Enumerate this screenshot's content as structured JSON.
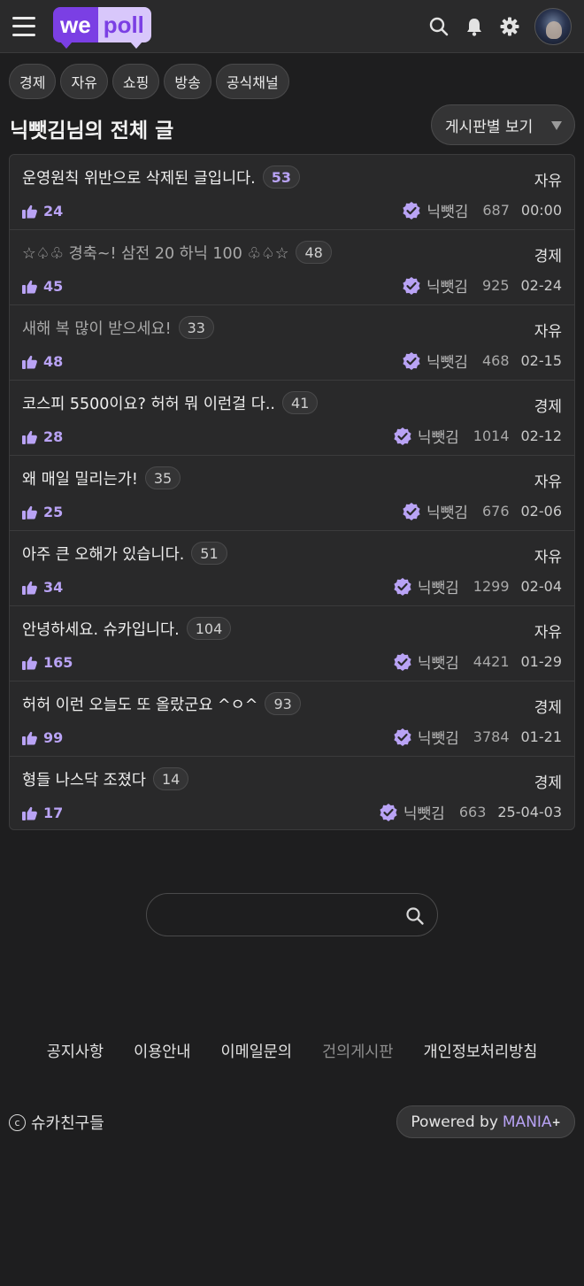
{
  "header": {
    "logo_we": "we",
    "logo_poll": "poll",
    "icons": [
      "search-icon",
      "bell-icon",
      "gear-icon"
    ]
  },
  "categories": [
    "경제",
    "자유",
    "쇼핑",
    "방송",
    "공식채널"
  ],
  "page_title": "닉뺏김님의 전체 글",
  "board_select": "게시판별 보기",
  "posts": [
    {
      "title": "운영원칙 위반으로 삭제된 글입니다.",
      "comments": "53",
      "category": "자유",
      "likes": "24",
      "author": "닉뺏김",
      "views": "687",
      "date": "00:00"
    },
    {
      "title": "☆♤♧ 경축~! 삼전 20 하닉 100 ♧♤☆",
      "comments": "48",
      "category": "경제",
      "likes": "45",
      "author": "닉뺏김",
      "views": "925",
      "date": "02-24"
    },
    {
      "title": "새해 복 많이 받으세요!",
      "comments": "33",
      "category": "자유",
      "likes": "48",
      "author": "닉뺏김",
      "views": "468",
      "date": "02-15"
    },
    {
      "title": "코스피 5500이요? 허허 뭐 이런걸 다..",
      "comments": "41",
      "category": "경제",
      "likes": "28",
      "author": "닉뺏김",
      "views": "1014",
      "date": "02-12"
    },
    {
      "title": "왜 매일 밀리는가!",
      "comments": "35",
      "category": "자유",
      "likes": "25",
      "author": "닉뺏김",
      "views": "676",
      "date": "02-06"
    },
    {
      "title": "아주 큰 오해가 있습니다.",
      "comments": "51",
      "category": "자유",
      "likes": "34",
      "author": "닉뺏김",
      "views": "1299",
      "date": "02-04"
    },
    {
      "title": "안녕하세요. 슈카입니다.",
      "comments": "104",
      "category": "자유",
      "likes": "165",
      "author": "닉뺏김",
      "views": "4421",
      "date": "01-29"
    },
    {
      "title": "허허 이런 오늘도 또 올랐군요 ^ㅇ^",
      "comments": "93",
      "category": "경제",
      "likes": "99",
      "author": "닉뺏김",
      "views": "3784",
      "date": "01-21"
    },
    {
      "title": "형들 나스닥 조졌다",
      "comments": "14",
      "category": "경제",
      "likes": "17",
      "author": "닉뺏김",
      "views": "663",
      "date": "25-04-03"
    }
  ],
  "search": {
    "value": "",
    "placeholder": ""
  },
  "footer": {
    "links": [
      "공지사항",
      "이용안내",
      "이메일문의",
      "건의게시판",
      "개인정보처리방침"
    ],
    "copyright_symbol": "c",
    "copyright": "슈카친구들",
    "powered_prefix": "Powered by",
    "powered_brand": "MANIA",
    "powered_sup": "+"
  },
  "colors": {
    "accent": "#b9a3f5",
    "brand": "#7b3fe4",
    "background": "#1e1e1f",
    "card": "#29292a"
  }
}
